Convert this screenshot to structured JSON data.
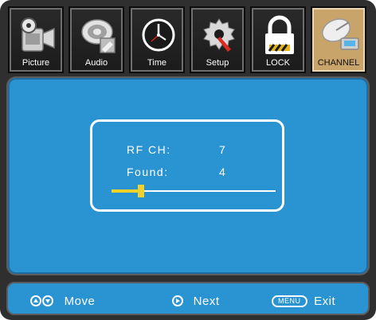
{
  "tabs": [
    {
      "label": "Picture",
      "icon": "camera-icon",
      "active": false
    },
    {
      "label": "Audio",
      "icon": "audio-icon",
      "active": false
    },
    {
      "label": "Time",
      "icon": "clock-icon",
      "active": false
    },
    {
      "label": "Setup",
      "icon": "settings-wrench-icon",
      "active": false
    },
    {
      "label": "LOCK",
      "icon": "padlock-icon",
      "active": false
    },
    {
      "label": "CHANNEL",
      "icon": "satellite-dish-icon",
      "active": true
    }
  ],
  "scan": {
    "rf_label": "RF  CH:",
    "rf_value": "7",
    "found_label": "Found:",
    "found_value": "4",
    "progress_fraction": 0.18
  },
  "footer": {
    "move_label": "Move",
    "next_label": "Next",
    "menu_key": "MENU",
    "exit_label": "Exit"
  },
  "colors": {
    "panel": "#2a93d2",
    "active_tab": "#c9a46a",
    "progress": "#f2d22a"
  }
}
